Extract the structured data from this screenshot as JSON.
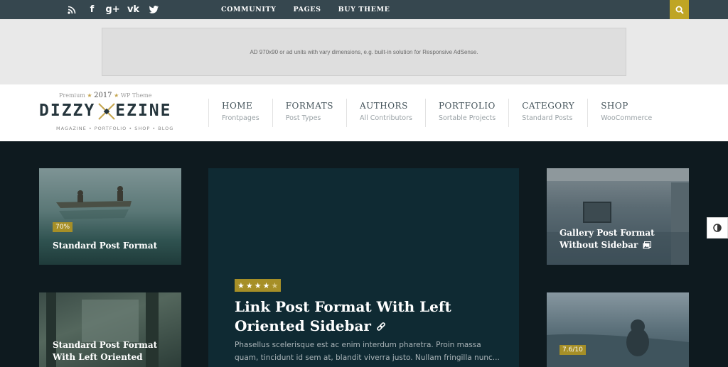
{
  "topbar": {
    "social_icons": [
      "rss-icon",
      "facebook-icon",
      "google-plus-icon",
      "vk-icon",
      "twitter-icon"
    ],
    "social_glyphs": [
      "",
      "f",
      "g+",
      "vk",
      ""
    ],
    "nav": [
      "COMMUNITY",
      "PAGES",
      "BUY THEME"
    ],
    "search_icon": "search-icon",
    "accent": "#bfa524",
    "background": "#36474f"
  },
  "ad": {
    "text": "AD 970x90 or ad units with vary dimensions, e.g. built-in solution for Responsive AdSense."
  },
  "logo": {
    "premium": "Premium",
    "year": "2017",
    "wp_theme": "WP Theme",
    "left_word": "DIZZY",
    "right_word": "EZINE",
    "tagline": "MAGAZINE • PORTFOLIO • SHOP • BLOG"
  },
  "main_nav": [
    {
      "title": "HOME",
      "subtitle": "Frontpages"
    },
    {
      "title": "FORMATS",
      "subtitle": "Post Types"
    },
    {
      "title": "AUTHORS",
      "subtitle": "All Contributors"
    },
    {
      "title": "PORTFOLIO",
      "subtitle": "Sortable Projects"
    },
    {
      "title": "CATEGORY",
      "subtitle": "Standard Posts"
    },
    {
      "title": "SHOP",
      "subtitle": "WooCommerce"
    }
  ],
  "posts": {
    "left_top": {
      "badge": "70%",
      "title": "Standard Post Format"
    },
    "left_bottom": {
      "title_line1": "Standard Post Format",
      "title_line2": "With Left Oriented"
    },
    "featured": {
      "rating_stars": 4.5,
      "title_line1": "Link Post Format With Left",
      "title_line2": "Oriented Sidebar",
      "link_icon": "link-icon",
      "excerpt_line1": "Phasellus scelerisque est ac enim interdum pharetra. Proin massa",
      "excerpt_line2": "quam, tincidunt id sem at, blandit viverra justo. Nullam fringilla nunc..."
    },
    "right_top": {
      "title_line1": "Gallery Post Format",
      "title_line2": "Without Sidebar",
      "icon": "gallery-icon"
    },
    "right_bottom": {
      "badge": "7.6/10"
    }
  },
  "side_toggle": {
    "icon": "contrast-icon"
  },
  "colors": {
    "badge": "#a68f27",
    "dark_bg": "#0e1a1f",
    "featured_bg": "#0f2a33"
  }
}
